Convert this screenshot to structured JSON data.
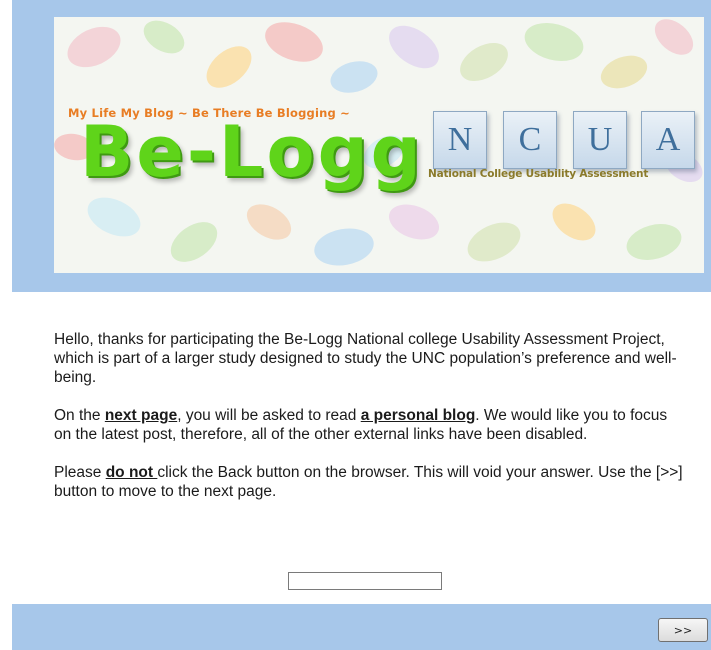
{
  "banner": {
    "tagline": "My Life My Blog ~ Be There Be Blogging ~",
    "logo": "Be-Logg",
    "letters": [
      "N",
      "C",
      "U",
      "A"
    ],
    "subtitle": "National College Usability Assessment"
  },
  "body": {
    "para1": "Hello, thanks for participating the Be-Logg National college Usability Assessment Project, which is part of a larger study designed to study the UNC population’s preference and well-being.",
    "para2_pre": "On the ",
    "para2_link1": "next page",
    "para2_mid": ", you will be asked to read ",
    "para2_link2": "a personal blog",
    "para2_post": ". We would like you to focus on the latest post, therefore, all of the other external links have been disabled.",
    "para3_pre": "Please ",
    "para3_emph": "do not ",
    "para3_post": "click the Back button on the browser. This will void your answer. Use the [>>]  button to move to the next page."
  },
  "input": {
    "value": ""
  },
  "nav": {
    "next_label": ">>"
  },
  "colors": {
    "band": "#a7c7ea",
    "logo_green": "#5fd41a",
    "tagline_orange": "#e87d24"
  }
}
